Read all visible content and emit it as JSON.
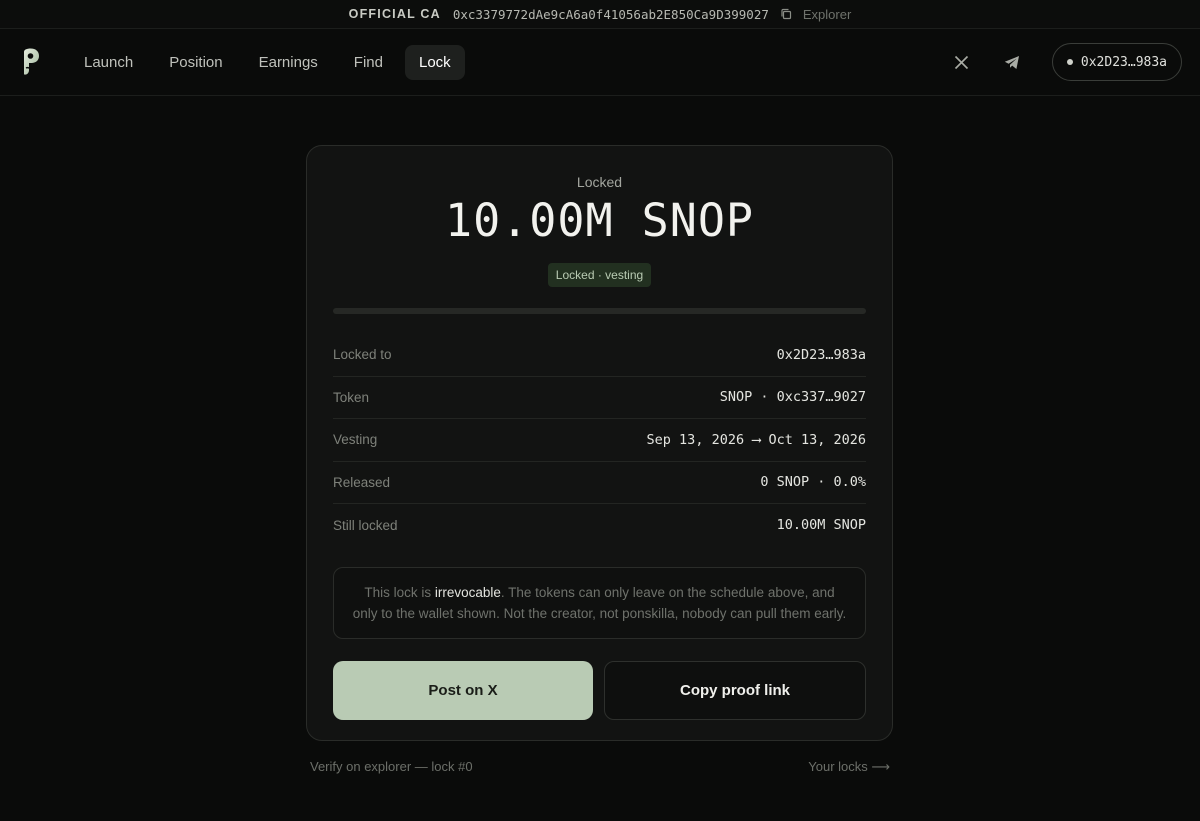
{
  "ca_bar": {
    "label": "OFFICIAL CA",
    "address": "0xc3379772dAe9cA6a0f41056ab2E850Ca9D399027",
    "explorer": "Explorer"
  },
  "nav": {
    "items": [
      {
        "label": "Launch",
        "active": false
      },
      {
        "label": "Position",
        "active": false
      },
      {
        "label": "Earnings",
        "active": false
      },
      {
        "label": "Find",
        "active": false
      },
      {
        "label": "Lock",
        "active": true
      }
    ],
    "wallet": "0x2D23…983a"
  },
  "lock": {
    "heading": "Locked",
    "amount": "10.00M SNOP",
    "status": "Locked · vesting",
    "released_fraction": 0.0,
    "rows": [
      {
        "label": "Locked to",
        "value": "0x2D23…983a"
      },
      {
        "label": "Token",
        "value": "SNOP · 0xc337…9027"
      },
      {
        "label": "Vesting",
        "value": "Sep 13, 2026 ⟶ Oct 13, 2026"
      },
      {
        "label": "Released",
        "value": "0 SNOP · 0.0%"
      },
      {
        "label": "Still locked",
        "value": "10.00M SNOP"
      }
    ],
    "note": {
      "before": "This lock is ",
      "emphasis": "irrevocable",
      "after": ". The tokens can only leave on the schedule above, and only to the wallet shown. Not the creator, not ponskilla, nobody can pull them early."
    },
    "buttons": {
      "post": "Post on X",
      "copy": "Copy proof link"
    }
  },
  "footer": {
    "verify": "Verify on explorer — lock #0",
    "your_locks": "Your locks ⟶"
  },
  "colors": {
    "accent": "#b9cbb4",
    "background": "#0a0b0a",
    "card": "#121312"
  }
}
